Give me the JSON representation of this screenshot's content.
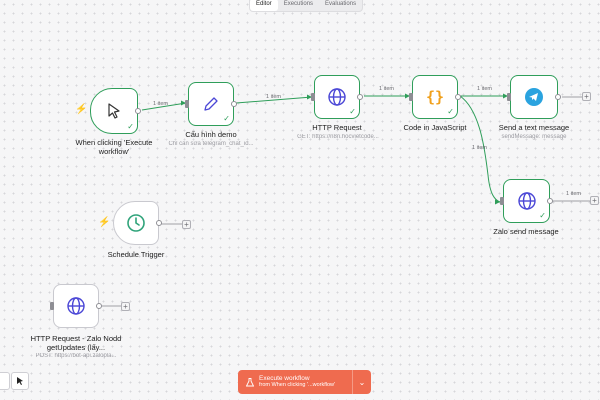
{
  "tabs": [
    "Editor",
    "Executions",
    "Evaluations"
  ],
  "nodes": {
    "manual_trigger": {
      "title": "When clicking 'Execute workflow'"
    },
    "cau_hinh": {
      "title": "Cấu hình demo",
      "subtitle": "Chỉ cần sửa telegram_chat_id..."
    },
    "http_request": {
      "title": "HTTP Request",
      "subtitle": "GET: https://n8n.hocvietcode..."
    },
    "code_js": {
      "title": "Code in JavaScript"
    },
    "send_text": {
      "title": "Send a text message",
      "subtitle": "sendMessage: message"
    },
    "zalo_send": {
      "title": "Zalo send message"
    },
    "schedule": {
      "title": "Schedule Trigger"
    },
    "http_zalo": {
      "title": "HTTP Request - Zalo Nodd getUpdates (lấy...",
      "subtitle": "POST: https://bot-api.zalopla..."
    }
  },
  "edge_labels": {
    "e1": "1 item",
    "e2": "1 item",
    "e3": "1 item",
    "e4": "1 item",
    "e5": "1 item",
    "e6": "1 item"
  },
  "execute": {
    "label": "Execute workflow",
    "sub": "from When clicking '...workflow'"
  },
  "icons": {
    "manual_trigger": "cursor-icon",
    "cau_hinh": "pencil-icon",
    "http": "globe-icon",
    "code": "braces-icon",
    "telegram": "telegram-icon",
    "schedule": "clock-icon"
  },
  "colors": {
    "success": "#2f9e5a",
    "execute": "#ef6b4f",
    "bolt": "#ef5a4b",
    "globe": "#4b47d6",
    "telegram": "#2aa3df",
    "code": "#f0a01c",
    "clock": "#2fa37a"
  }
}
